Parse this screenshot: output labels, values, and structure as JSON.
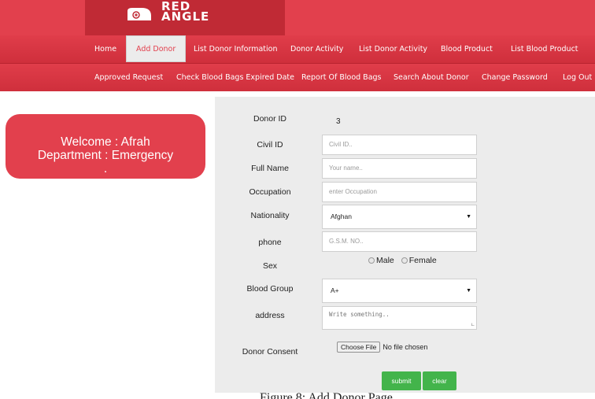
{
  "brand": {
    "line1": "RED",
    "line2": "ANGLE"
  },
  "nav_primary": [
    {
      "label": "Home"
    },
    {
      "label": "Add Donor"
    },
    {
      "label": "List Donor Information"
    },
    {
      "label": "Donor Activity"
    },
    {
      "label": "List Donor Activity"
    },
    {
      "label": "Blood Product"
    },
    {
      "label": "List Blood Product"
    }
  ],
  "nav_secondary": [
    {
      "label": "Approved Request"
    },
    {
      "label": "Check Blood Bags Expired Date"
    },
    {
      "label": "Report Of Blood Bags"
    },
    {
      "label": "Search About Donor"
    },
    {
      "label": "Change Password"
    },
    {
      "label": "Log Out"
    }
  ],
  "welcome": {
    "line1": "Welcome : Afrah",
    "line2": "Department : Emergency",
    "line3": "."
  },
  "form": {
    "donor_id_label": "Donor ID",
    "donor_id_value": "3",
    "civil_id_label": "Civil ID",
    "civil_id_placeholder": "Civil ID..",
    "full_name_label": "Full Name",
    "full_name_placeholder": "Your name..",
    "occupation_label": "Occupation",
    "occupation_placeholder": "enter Occupation",
    "nationality_label": "Nationality",
    "nationality_value": "Afghan",
    "phone_label": "phone",
    "phone_placeholder": "G.S.M. NO..",
    "sex_label": "Sex",
    "sex_options": [
      "Male",
      "Female"
    ],
    "blood_group_label": "Blood Group",
    "blood_group_value": "A+",
    "address_label": "address",
    "address_placeholder": "Write something..",
    "consent_label": "Donor Consent",
    "choose_file_label": "Choose File",
    "no_file_text": "No file chosen",
    "submit_label": "submit",
    "clear_label": "clear"
  },
  "caption": "Figure 8: Add Donor Page",
  "colors": {
    "brand_red": "#e2404d",
    "dark_red": "#c02a35",
    "button_green": "#43b44b",
    "form_bg": "#ececec"
  }
}
